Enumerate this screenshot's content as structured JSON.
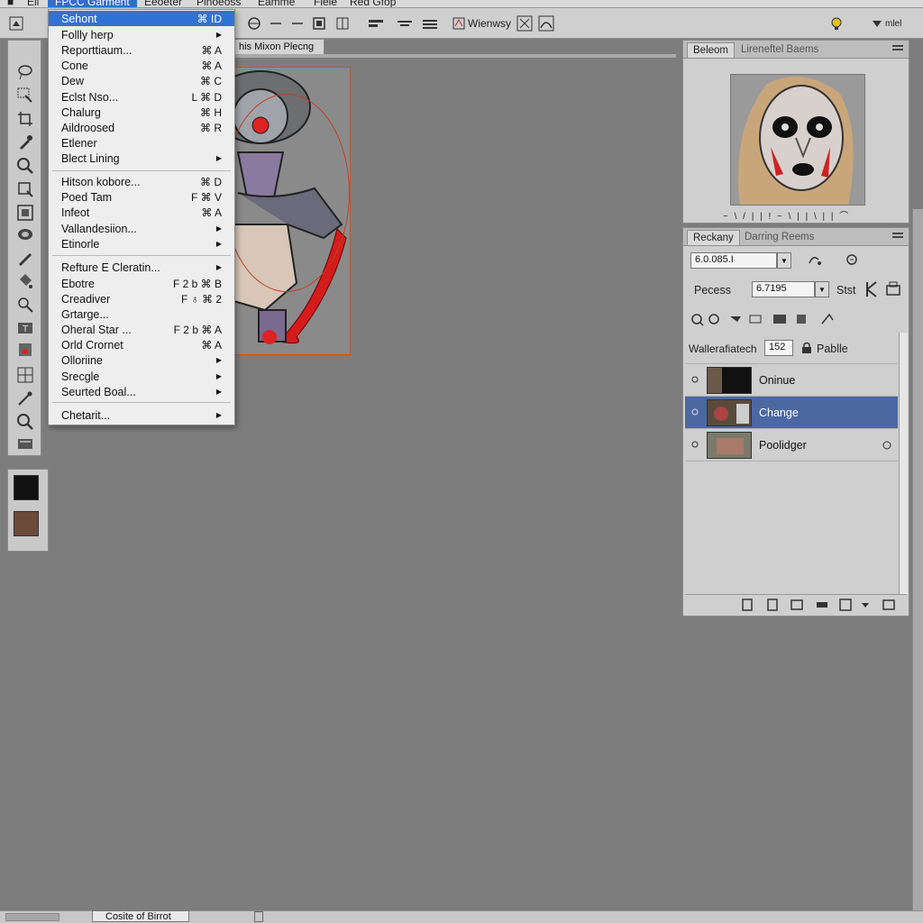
{
  "menubar": {
    "items": [
      "Eil",
      "FPCC Garment",
      "Eeoeter",
      "Pinoeoss",
      "Eamme",
      "Fiele",
      "Red Gfop"
    ],
    "active_index": 1
  },
  "options_bar": {
    "workspace_label": "Wienwsy",
    "right_label": "mlel"
  },
  "document": {
    "tab_title": "his Mixon Plecng",
    "status_text": "Cosite of Birrot"
  },
  "dropdown_menu": {
    "items": [
      {
        "label": "Sehont",
        "shortcut": "⌘ ID",
        "highlighted": true
      },
      {
        "label": "Follly herp",
        "submenu": true
      },
      {
        "label": "Reporttiaum...",
        "shortcut": "⌘ A"
      },
      {
        "label": "Cone",
        "shortcut": "⌘ A"
      },
      {
        "label": "Dew",
        "shortcut": "⌘ C"
      },
      {
        "label": "Eclst Nso...",
        "shortcut": "L ⌘ D"
      },
      {
        "label": "Chalurg",
        "shortcut": "⌘ H"
      },
      {
        "label": "Aildroosed",
        "shortcut": "⌘ R"
      },
      {
        "label": "Etlener"
      },
      {
        "label": "Blect Lining",
        "submenu": true
      },
      {
        "label": "Hitson kobore...",
        "shortcut": "⌘ D"
      },
      {
        "label": "Poed Tam",
        "shortcut": "F ⌘ V"
      },
      {
        "label": "Infeot",
        "shortcut": "⌘ A"
      },
      {
        "label": "Vallandesiion...",
        "submenu": true
      },
      {
        "label": "Etinorle",
        "submenu": true
      },
      {
        "label": "Refture E Cleratin...",
        "submenu": true
      },
      {
        "label": "Ebotre",
        "shortcut": "F 2 b ⌘ B"
      },
      {
        "label": "Creadiver",
        "shortcut": "F ♁ ⌘ 2"
      },
      {
        "label": "Grtarge..."
      },
      {
        "label": "Oheral Star ...",
        "shortcut": "F 2 b ⌘ A"
      },
      {
        "label": "Orld Crornet",
        "shortcut": "⌘ A"
      },
      {
        "label": "Olloriine",
        "submenu": true
      },
      {
        "label": "Srecgle",
        "submenu": true
      },
      {
        "label": "Seurted Boal...",
        "submenu": true
      },
      {
        "label": "Chetarit...",
        "submenu": true
      }
    ]
  },
  "navigator_panel": {
    "tabs": [
      "Beleom",
      "Lireneftel Baems"
    ],
    "ruler_text": "~ \\ / | | ! ~ \\ | | \\ | | ⌒"
  },
  "layers_panel": {
    "tabs": [
      "Reckany",
      "Darring Reems"
    ],
    "blend_mode": "6.0.085.I",
    "opacity_label": "Pecess",
    "opacity_value": "6.7195",
    "stat_label": "Stst",
    "fill_label": "Wallerafiatech",
    "fill_value": "152",
    "lock_label": "Pablle",
    "layers": [
      {
        "name": "Oninue",
        "selected": false
      },
      {
        "name": "Change",
        "selected": true
      },
      {
        "name": "Poolidger",
        "selected": false
      }
    ]
  },
  "colors": {
    "accent": "#2f73d6",
    "layer_selected": "#4b68a2",
    "workspace": "#7d7d7d"
  }
}
